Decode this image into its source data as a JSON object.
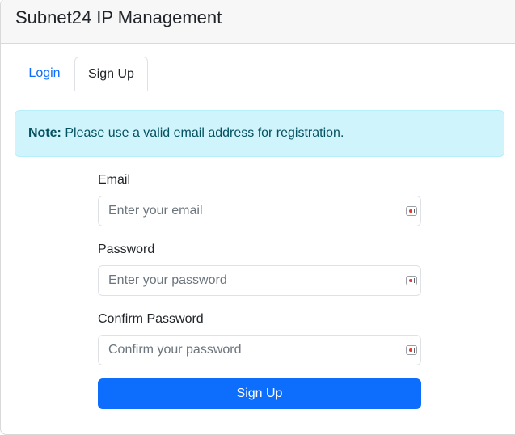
{
  "header": {
    "title": "Subnet24 IP Management"
  },
  "tabs": [
    {
      "label": "Login",
      "active": false
    },
    {
      "label": "Sign Up",
      "active": true
    }
  ],
  "alert": {
    "prefix": "Note:",
    "message": " Please use a valid email address for registration."
  },
  "form": {
    "email": {
      "label": "Email",
      "placeholder": "Enter your email",
      "value": ""
    },
    "password": {
      "label": "Password",
      "placeholder": "Enter your password",
      "value": ""
    },
    "confirm": {
      "label": "Confirm Password",
      "placeholder": "Confirm your password",
      "value": ""
    },
    "submit_label": "Sign Up"
  },
  "colors": {
    "primary": "#0d6efd",
    "alert_bg": "#cff4fc",
    "alert_text": "#055160"
  }
}
